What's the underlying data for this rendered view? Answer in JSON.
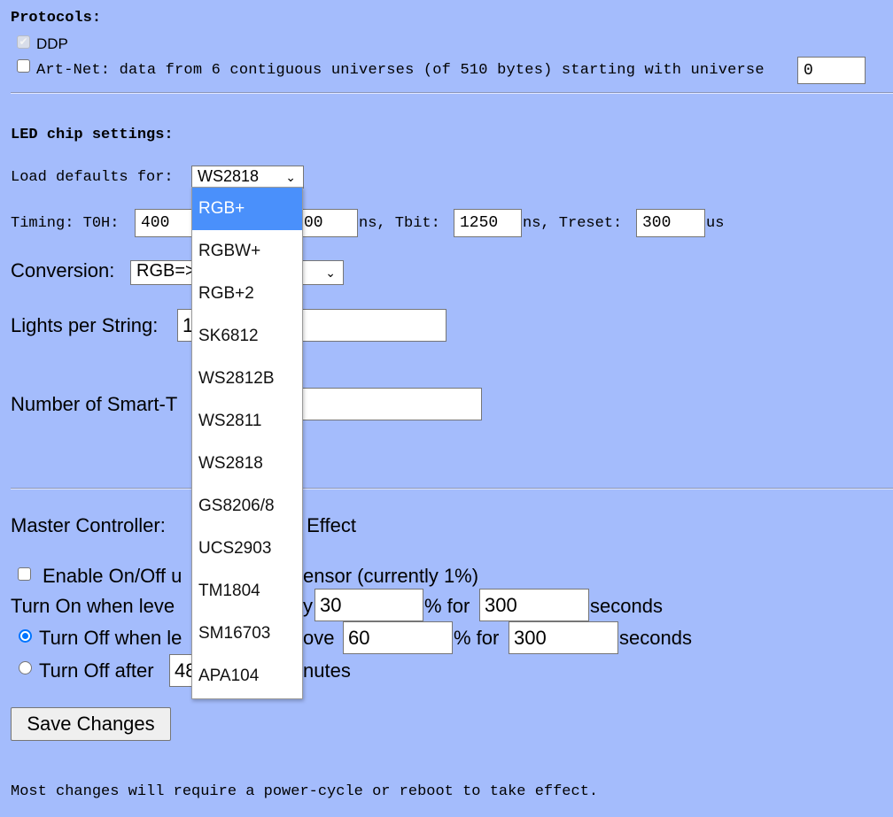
{
  "protocols": {
    "heading": "Protocols:",
    "ddp": {
      "label": "DDP",
      "checked": true,
      "disabled": true
    },
    "artnet": {
      "label": "Art-Net: data from 6 contiguous universes (of 510 bytes) starting with universe",
      "checked": false,
      "universe": "0"
    }
  },
  "led_chip": {
    "heading": "LED chip settings:",
    "load_defaults_label": "Load defaults for:",
    "load_defaults_value": "WS2818",
    "timing": {
      "label": "Timing: T0H:",
      "t0h": "400",
      "t1h_visible": "00",
      "ns_tbit": "ns, Tbit:",
      "tbit": "1250",
      "ns_treset": "ns, Treset:",
      "treset": "300",
      "us": "us"
    },
    "conversion_label": "Conversion:",
    "conversion_value_visible": "RGB=>",
    "lights_label": "Lights per String:",
    "lights_value_visible": "1",
    "smart_label_visible": "Number of Smart-T"
  },
  "master": {
    "label": "Master Controller:",
    "value_visible": "y Effect"
  },
  "sensor": {
    "enable_visible_start": "Enable On/Off u",
    "enable_visible_end": "ensor (currently 1%)",
    "enabled": false,
    "turn_on_start": "Turn On when leve",
    "turn_on_end": "y",
    "turn_on_level": "30",
    "pct_for": "% for",
    "turn_on_seconds": "300",
    "seconds": "seconds",
    "turn_off_level_start": "Turn Off when le",
    "turn_off_level_end": "ove",
    "turn_off_level": "60",
    "turn_off_seconds": "300",
    "turn_off_level_selected": true,
    "turn_off_after_label": "Turn Off after",
    "turn_off_after_value": "48",
    "minutes_visible": "nutes"
  },
  "save_label": "Save Changes",
  "footer": "Most changes will require a power-cycle or reboot to take effect.",
  "dropdown": {
    "options": [
      "RGB+",
      "RGBW+",
      "RGB+2",
      "SK6812",
      "WS2812B",
      "WS2811",
      "WS2818",
      "GS8206/8",
      "UCS2903",
      "TM1804",
      "SM16703",
      "APA104"
    ],
    "highlighted": "RGB+",
    "highlight_color": "#4a90fb"
  }
}
